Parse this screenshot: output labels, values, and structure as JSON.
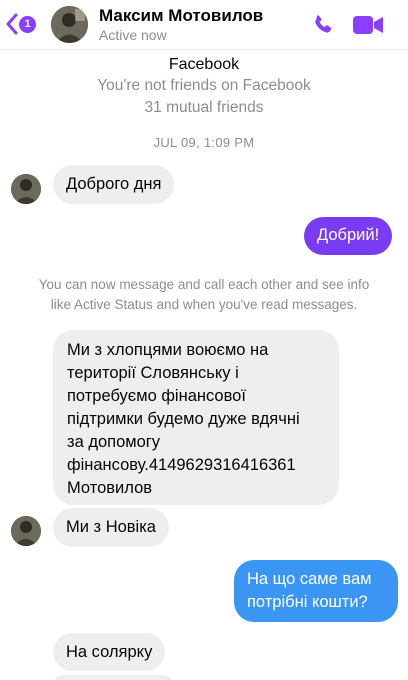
{
  "header": {
    "back_badge": "1",
    "contact_name": "Максим Мотовилов",
    "contact_status": "Active now",
    "accent_color": "#8a3ffc"
  },
  "info": {
    "platform": "Facebook",
    "friend_status": "You're not friends on Facebook",
    "mutual": "31 mutual friends"
  },
  "timestamp": "JUL 09, 1:09 PM",
  "messages": [
    {
      "direction": "incoming",
      "text": "Доброго дня"
    },
    {
      "direction": "outgoing",
      "text": "Добрий!"
    },
    {
      "direction": "incoming",
      "lines": [
        "Ми з хлопцями воюємо на",
        "території Словянську і",
        "потребуємо фінансової",
        "підтримки будемо дуже вдячні",
        "за допомогу",
        "фінансову.4149629316416361",
        "Мотовилов"
      ]
    },
    {
      "direction": "incoming",
      "text": "Ми з Новіка"
    },
    {
      "direction": "outgoing",
      "lines": [
        "На що саме вам",
        "потрібні кошти?"
      ]
    },
    {
      "direction": "incoming",
      "text": "На солярку"
    }
  ],
  "notice": {
    "line1": "You can now message and call each other and see info",
    "line2": "like Active Status and when you've read messages."
  },
  "icons": {
    "back": "chevron-left-icon",
    "call": "phone-icon",
    "video": "video-camera-icon"
  },
  "colors": {
    "outgoing_purple": "#7a3cf0",
    "outgoing_blue": "#3b95f3",
    "incoming_gray": "#eeeeef"
  }
}
